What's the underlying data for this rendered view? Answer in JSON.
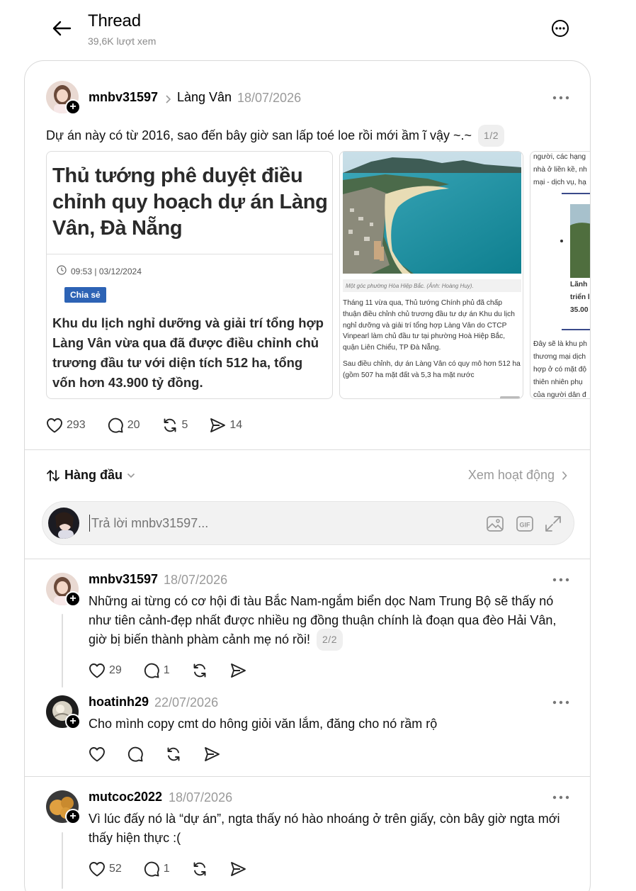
{
  "header": {
    "title": "Thread",
    "views": "39,6K lượt xem"
  },
  "post": {
    "username": "mnbv31597",
    "community": "Làng Vân",
    "date": "18/07/2026",
    "text": "Dự án này có từ 2016, sao đến bây giờ san lấp toé loe rồi mới ầm ĩ vậy ~.~",
    "counter": "1/2",
    "likes": "293",
    "comments": "20",
    "reposts": "5",
    "shares": "14",
    "article1": {
      "title": "Thủ tướng phê duyệt điều chỉnh quy hoạch dự án Làng Vân, Đà Nẵng",
      "time": "09:53 | 03/12/2024",
      "share_label": "Chia sẻ",
      "body": "Khu du lịch nghỉ dưỡng và giải trí tổng hợp Làng Vân vừa qua đã được điều chỉnh chủ trương đầu tư với diện tích 512 ha, tổng vốn hơn 43.900 tỷ đồng."
    },
    "article2": {
      "caption": "Một góc phường Hòa Hiệp Bắc. (Ảnh: Hoàng Huy).",
      "para1": "Tháng 11 vừa qua, Thủ tướng Chính phủ đã chấp thuận điều chỉnh chủ trương đầu tư dự án Khu du lịch nghỉ dưỡng và giải trí tổng hợp Làng Vân do CTCP Vinpearl làm chủ đầu tư tại phường Hoà Hiệp Bắc, quận Liên Chiểu, TP Đà Nẵng.",
      "para2": "Sau điều chỉnh, dự án Làng Vân có quy mô hơn 512 ha (gồm 507 ha mặt đất và 5,3 ha mặt nước"
    },
    "article3": {
      "line1": "người, các hạng",
      "line2": "nhà ở liền kề, nh",
      "line3": "mại - dịch vụ, hạ",
      "box_line1": "Lãnh",
      "box_line2": "triển l",
      "box_line3": "35.00",
      "line4": "Đây sẽ là khu ph",
      "line5": "thương mại dịch",
      "line6": "hợp ở có mặt độ",
      "line7": "thiên nhiên phụ",
      "line8": "của người dân đ"
    }
  },
  "sort": {
    "label": "Hàng đầu",
    "activity": "Xem hoạt động"
  },
  "reply": {
    "placeholder": "Trả lời mnbv31597..."
  },
  "comments": [
    {
      "username": "mnbv31597",
      "date": "18/07/2026",
      "text": "Những ai từng có cơ hội đi tàu Bắc Nam-ngắm biển dọc Nam Trung Bộ sẽ thấy nó như tiên cảnh-đẹp nhất được nhiều ng đồng thuận chính là đoạn qua đèo Hải Vân, giờ bị biến thành phàm cảnh mẹ nó rồi!",
      "counter": "2/2",
      "likes": "29",
      "comments": "1"
    },
    {
      "username": "hoatinh29",
      "date": "22/07/2026",
      "text": "Cho mình copy cmt do hông giỏi văn lắm, đăng cho nó rầm rộ"
    },
    {
      "username": "mutcoc2022",
      "date": "18/07/2026",
      "text": "Vì lúc đấy nó là “dự án”, ngta thấy nó hào nhoáng ở trên giấy, còn bây giờ ngta mới thấy hiện thực :(",
      "likes": "52",
      "comments": "1"
    }
  ],
  "colors": {
    "share_badge": "#2d63b5",
    "muted": "#9a9a9a",
    "border": "#d9d9d9"
  },
  "icons": [
    "back-arrow-icon",
    "more-circle-icon",
    "plus-icon",
    "chevron-right-icon",
    "more-dots-icon",
    "heart-icon",
    "comment-icon",
    "repost-icon",
    "share-icon",
    "sort-icon",
    "chevron-down-icon",
    "image-icon",
    "gif-icon",
    "expand-icon",
    "clock-icon"
  ]
}
